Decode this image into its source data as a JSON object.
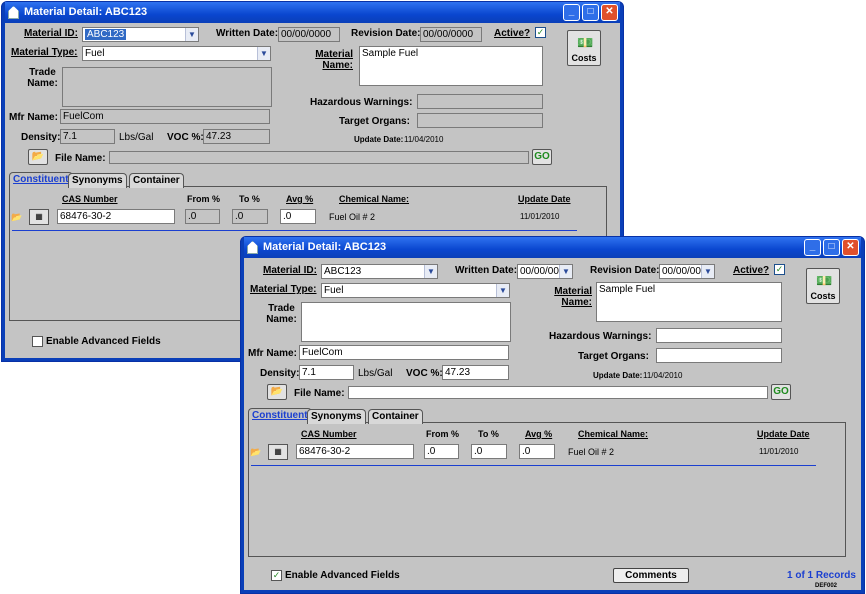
{
  "window_back": {
    "title": "Material Detail:  ABC123",
    "material_id_label": "Material ID:",
    "material_id_value": "ABC123",
    "written_date_label": "Written Date:",
    "written_date_value": "00/00/0000",
    "revision_date_label": "Revision Date:",
    "revision_date_value": "00/00/0000",
    "active_label": "Active?",
    "active_check": "✓",
    "material_type_label": "Material Type:",
    "material_type_value": "Fuel",
    "trade_name_label": "Trade Name:",
    "material_name_label": "Material Name:",
    "material_name_value": "Sample Fuel",
    "costs_label": "Costs",
    "hazardous_label": "Hazardous Warnings:",
    "target_organs_label": "Target Organs:",
    "mfr_name_label": "Mfr Name:",
    "mfr_name_value": "FuelCom",
    "density_label": "Density:",
    "density_value": "7.1",
    "density_unit": "Lbs/Gal",
    "voc_label": "VOC %:",
    "voc_value": "47.23",
    "update_date_label": "Update Date:",
    "update_date_value": "11/04/2010",
    "file_name_label": "File Name:",
    "go_label": "GO",
    "tabs": [
      "Constituent",
      "Synonyms",
      "Container"
    ],
    "columns": {
      "cas": "CAS Number",
      "from": "From %",
      "to": "To %",
      "avg": "Avg %",
      "chem": "Chemical Name:",
      "update": "Update Date"
    },
    "row": {
      "cas": "68476-30-2",
      "from": ".0",
      "to": ".0",
      "avg": ".0",
      "chem": "Fuel Oil # 2",
      "update": "11/01/2010"
    },
    "enable_advanced": "Enable Advanced Fields"
  },
  "window_front": {
    "title": "Material Detail:  ABC123",
    "material_id_label": "Material ID:",
    "material_id_value": "ABC123",
    "written_date_label": "Written Date:",
    "written_date_value": "00/00/0000",
    "revision_date_label": "Revision Date:",
    "revision_date_value": "00/00/0000",
    "active_label": "Active?",
    "active_check": "✓",
    "material_type_label": "Material Type:",
    "material_type_value": "Fuel",
    "trade_name_label": "Trade Name:",
    "material_name_label": "Material Name:",
    "material_name_value": "Sample Fuel",
    "costs_label": "Costs",
    "hazardous_label": "Hazardous Warnings:",
    "target_organs_label": "Target Organs:",
    "mfr_name_label": "Mfr Name:",
    "mfr_name_value": "FuelCom",
    "density_label": "Density:",
    "density_value": "7.1",
    "density_unit": "Lbs/Gal",
    "voc_label": "VOC %:",
    "voc_value": "47.23",
    "update_date_label": "Update Date:",
    "update_date_value": "11/04/2010",
    "file_name_label": "File Name:",
    "go_label": "GO",
    "tabs": [
      "Constituent",
      "Synonyms",
      "Container"
    ],
    "columns": {
      "cas": "CAS Number",
      "from": "From %",
      "to": "To %",
      "avg": "Avg %",
      "chem": "Chemical Name:",
      "update": "Update Date"
    },
    "row": {
      "cas": "68476-30-2",
      "from": ".0",
      "to": ".0",
      "avg": ".0",
      "chem": "Fuel Oil # 2",
      "update": "11/01/2010"
    },
    "enable_advanced": "Enable Advanced Fields",
    "enable_check": "✓",
    "comments_label": "Comments",
    "records": "1 of 1 Records",
    "form_code": "DEF002"
  },
  "icons": {
    "minimize": "_",
    "maximize": "□",
    "close": "✕",
    "dropdown": "▼",
    "folder": "📂",
    "binoculars": "▦",
    "costs": "💵"
  }
}
